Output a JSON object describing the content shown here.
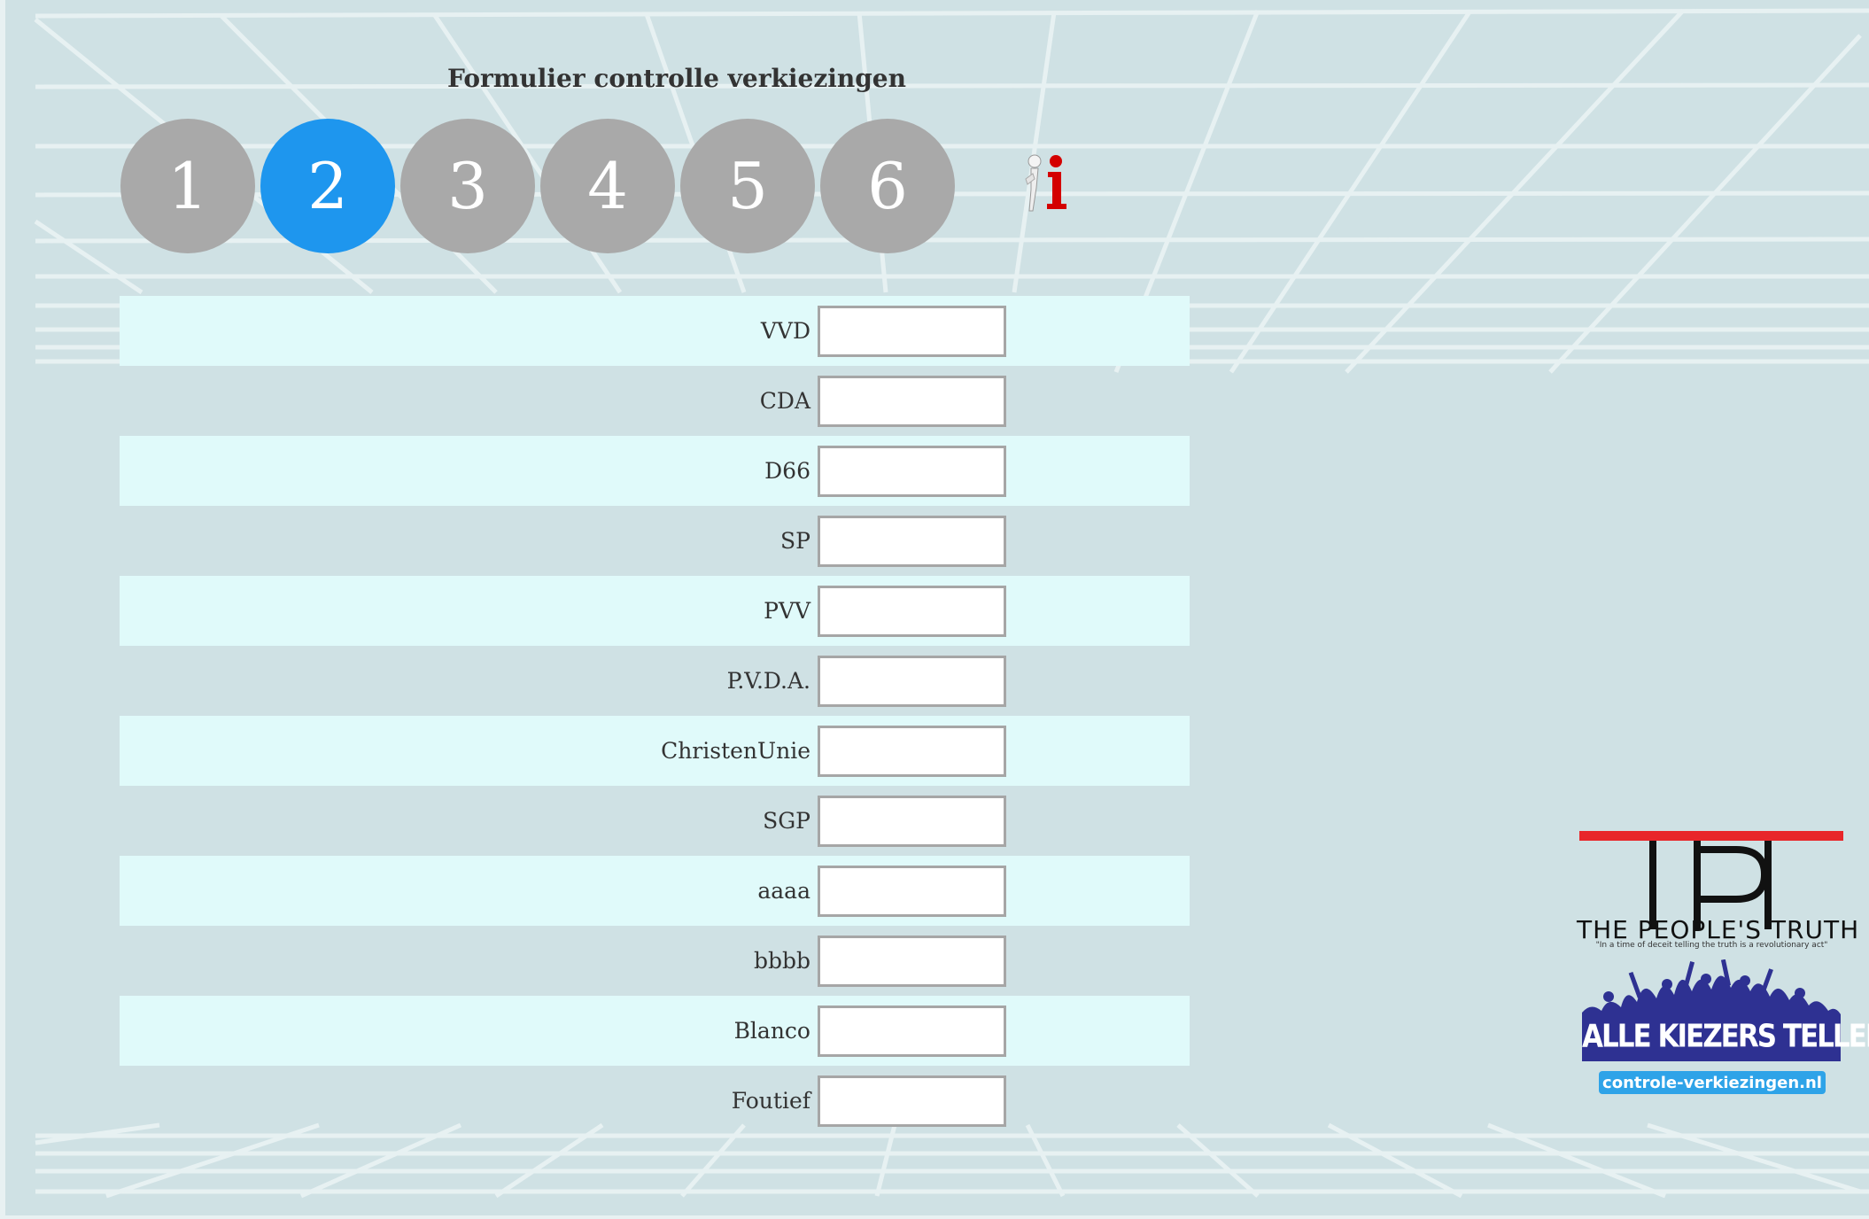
{
  "title": "Formulier controlle verkiezingen",
  "steps": [
    {
      "label": "1",
      "active": false
    },
    {
      "label": "2",
      "active": true
    },
    {
      "label": "3",
      "active": false
    },
    {
      "label": "4",
      "active": false
    },
    {
      "label": "5",
      "active": false
    },
    {
      "label": "6",
      "active": false
    }
  ],
  "info_icon": "info-icon",
  "parties": [
    {
      "label": "VVD",
      "value": ""
    },
    {
      "label": "CDA",
      "value": ""
    },
    {
      "label": "D66",
      "value": ""
    },
    {
      "label": "SP",
      "value": ""
    },
    {
      "label": "PVV",
      "value": ""
    },
    {
      "label": "P.V.D.A.",
      "value": ""
    },
    {
      "label": "ChristenUnie",
      "value": ""
    },
    {
      "label": "SGP",
      "value": ""
    },
    {
      "label": "aaaa",
      "value": ""
    },
    {
      "label": "bbbb",
      "value": ""
    },
    {
      "label": "Blanco",
      "value": ""
    },
    {
      "label": "Foutief",
      "value": ""
    }
  ],
  "logos": {
    "tpt_name": "THE PEOPLE'S TRUTH",
    "tpt_quote": "\"In a time of deceit telling the truth is a revolutionary act\"",
    "akm_name": "ALLE KIEZERS TELLEN MEE",
    "site": "controle-verkiezingen.nl"
  },
  "colors": {
    "background": "#cfe1e4",
    "row_highlight": "#e0fafa",
    "step_inactive": "#a9a9a9",
    "step_active": "#1e96ee",
    "tpt_red": "#e8262a",
    "akm_blue": "#2e3192",
    "site_badge": "#2ea3e8"
  }
}
